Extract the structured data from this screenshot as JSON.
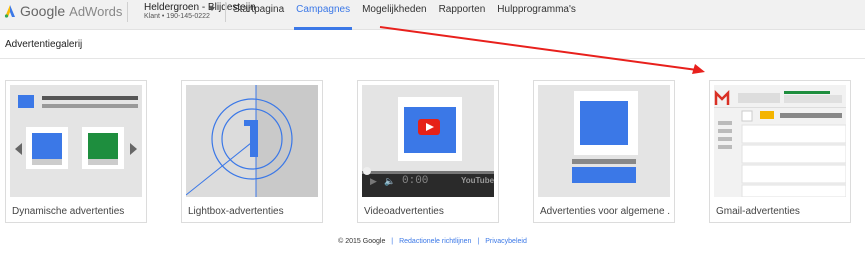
{
  "header": {
    "logo_google": "Google",
    "logo_adwords": "AdWords",
    "account_name": "Heldergroen - Blijdesteijn",
    "account_sub": "Klant  •  190-145-0222",
    "nav": [
      {
        "label": "Startpagina",
        "active": false
      },
      {
        "label": "Campagnes",
        "active": true
      },
      {
        "label": "Mogelijkheden",
        "active": false
      },
      {
        "label": "Rapporten",
        "active": false
      },
      {
        "label": "Hulpprogramma's",
        "active": false
      }
    ]
  },
  "page": {
    "title": "Advertentiegalerij"
  },
  "gallery": [
    {
      "label": "Dynamische advertenties",
      "icon": "dynamic-ads-icon"
    },
    {
      "label": "Lightbox-advertenties",
      "icon": "lightbox-ads-icon"
    },
    {
      "label": "Videoadvertenties",
      "icon": "video-ads-icon"
    },
    {
      "label": "Advertenties voor algemene ...",
      "icon": "universal-ads-icon"
    },
    {
      "label": "Gmail-advertenties",
      "icon": "gmail-ads-icon"
    }
  ],
  "video_player": {
    "time": "0:00",
    "brand": "YouTube"
  },
  "footer": {
    "copyright": "© 2015 Google",
    "link1": "Redactionele richtlijnen",
    "link2": "Privacybeleid"
  },
  "colors": {
    "accent": "#3b78e7",
    "annotation_arrow": "#e8201c"
  }
}
